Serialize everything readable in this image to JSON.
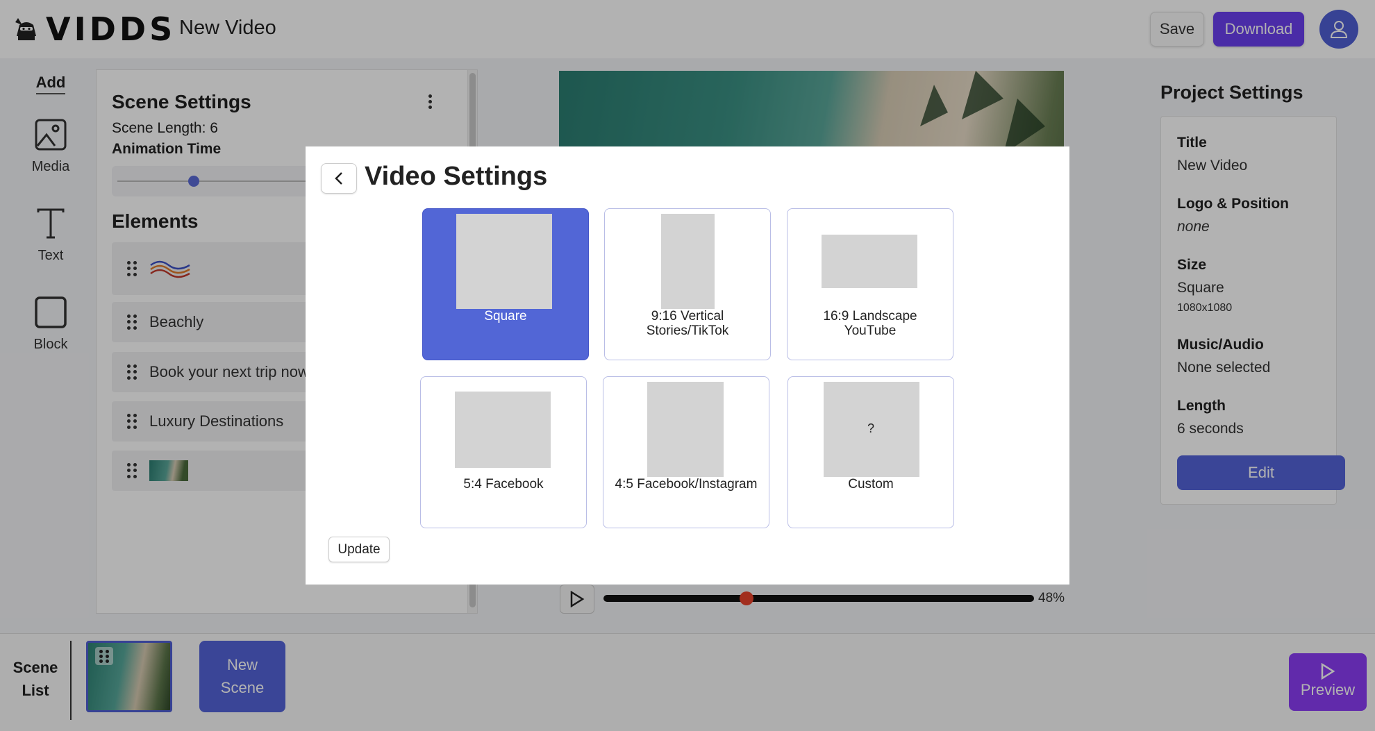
{
  "app": {
    "logo_text": "VIDDS",
    "project_name": "New Video"
  },
  "topbar": {
    "save_label": "Save",
    "download_label": "Download",
    "colors": {
      "download": "#6a3ff0",
      "avatar": "#4f5fd4"
    }
  },
  "add_rail": {
    "title": "Add",
    "items": [
      {
        "label": "Media",
        "icon": "image-icon"
      },
      {
        "label": "Text",
        "icon": "text-t-icon"
      },
      {
        "label": "Block",
        "icon": "square-icon"
      }
    ]
  },
  "scene_settings": {
    "title": "Scene Settings",
    "scene_length": "Scene Length: 6",
    "animation_time_label": "Animation Time",
    "elements_title": "Elements",
    "elements": [
      {
        "type": "wave-graphic",
        "label": ""
      },
      {
        "type": "text",
        "label": "Beachly"
      },
      {
        "type": "text",
        "label": "Book your next trip now"
      },
      {
        "type": "text",
        "label": "Luxury Destinations"
      },
      {
        "type": "image",
        "label": ""
      }
    ]
  },
  "player": {
    "progress_label": "48%",
    "progress_fraction": 0.32
  },
  "project_settings": {
    "title": "Project Settings",
    "fields": [
      {
        "label": "Title",
        "value": "New Video"
      },
      {
        "label": "Logo & Position",
        "value": "none"
      },
      {
        "label": "Size",
        "value": "Square",
        "detail": "1080x1080"
      },
      {
        "label": "Music/Audio",
        "value": "None selected"
      },
      {
        "label": "Length",
        "value": "6 seconds"
      }
    ],
    "edit_label": "Edit"
  },
  "scene_list": {
    "title_line1": "Scene",
    "title_line2": "List",
    "new_scene_line1": "New",
    "new_scene_line2": "Scene",
    "preview_label": "Preview"
  },
  "modal": {
    "title": "Video Settings",
    "update_label": "Update",
    "selected_color": "#5266d6",
    "options": [
      {
        "line1": "Square",
        "line2": "",
        "selected": true
      },
      {
        "line1": "9:16 Vertical",
        "line2": "Stories/TikTok",
        "selected": false
      },
      {
        "line1": "16:9 Landscape",
        "line2": "YouTube",
        "selected": false
      },
      {
        "line1": "5:4 Facebook",
        "line2": "",
        "selected": false
      },
      {
        "line1": "4:5 Facebook/Instagram",
        "line2": "",
        "selected": false
      },
      {
        "line1": "Custom",
        "line2": "",
        "placeholder": "?",
        "selected": false
      }
    ]
  }
}
